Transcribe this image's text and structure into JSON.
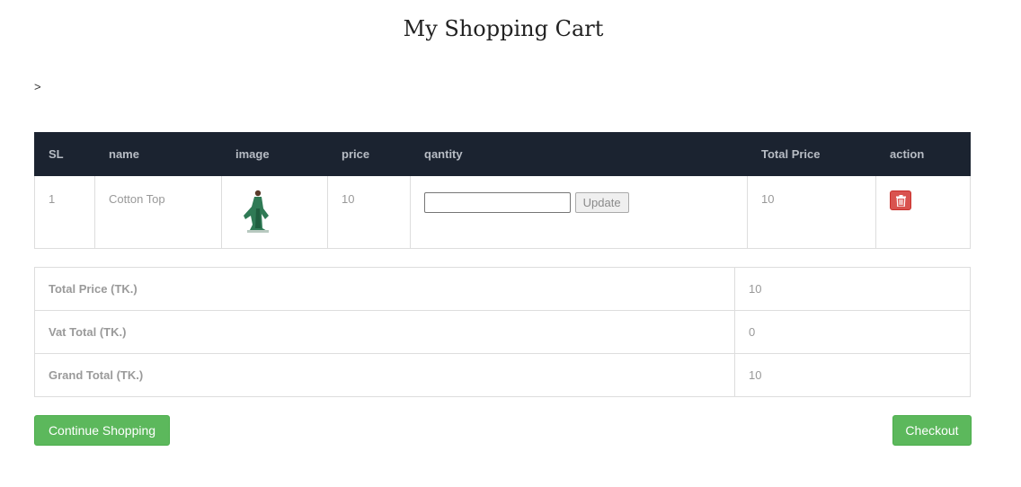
{
  "page": {
    "title": "My Shopping Cart",
    "breadcrumb": ">"
  },
  "cart": {
    "headers": {
      "sl": "SL",
      "name": "name",
      "image": "image",
      "price": "price",
      "quantity": "qantity",
      "total": "Total Price",
      "action": "action"
    },
    "rows": [
      {
        "sl": "1",
        "name": "Cotton Top",
        "image_icon": "green-dress-product-image",
        "price": "10",
        "quantity_value": "",
        "update_label": "Update",
        "total": "10",
        "delete_icon": "trash-icon"
      }
    ]
  },
  "totals": {
    "total_price_label": "Total Price (TK.)",
    "total_price": "10",
    "vat_label": "Vat Total (TK.)",
    "vat": "0",
    "grand_label": "Grand Total (TK.)",
    "grand": "10"
  },
  "actions": {
    "continue_label": "Continue Shopping",
    "checkout_label": "Checkout"
  },
  "colors": {
    "header_bg": "#1b2330",
    "success": "#5cb85c",
    "danger": "#d9534f"
  }
}
